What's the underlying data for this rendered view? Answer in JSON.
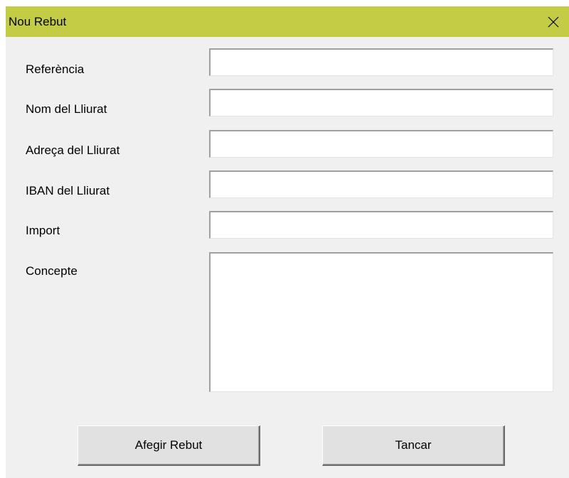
{
  "window": {
    "title": "Nou Rebut"
  },
  "form": {
    "fields": [
      {
        "label": "Referència",
        "value": ""
      },
      {
        "label": "Nom del Lliurat",
        "value": ""
      },
      {
        "label": "Adreça del Lliurat",
        "value": ""
      },
      {
        "label": "IBAN del Lliurat",
        "value": ""
      },
      {
        "label": "Import",
        "value": ""
      }
    ],
    "concept": {
      "label": "Concepte",
      "value": ""
    }
  },
  "buttons": {
    "add_label": "Afegir Rebut",
    "close_label": "Tancar"
  },
  "colors": {
    "titlebar": "#c4cb45",
    "dialog_background": "#f0f0f0",
    "button_face": "#e1e1e1"
  },
  "icons": {
    "close": "close-icon"
  }
}
